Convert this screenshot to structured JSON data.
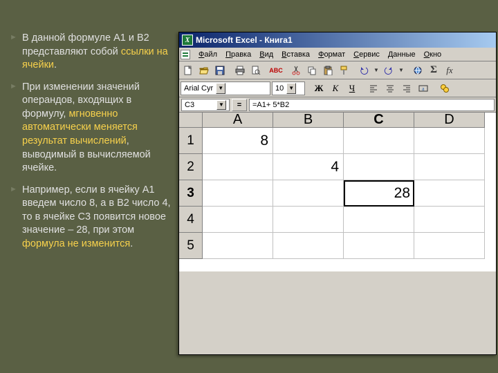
{
  "slide": {
    "bullets": [
      {
        "p1": "В данной формуле А1 и В2 представляют собой ",
        "y1": "ссылки на ячейки",
        "p2": "."
      },
      {
        "p1": "При изменении значений операндов, входящих в формулу, ",
        "y1": "мгновенно автоматически меняется результат вычислений",
        "p2": ", выводимый в вычисляемой ячейке."
      },
      {
        "p1": "Например, если в ячейку А1 введем число 8, а в В2 число 4, то в ячейке С3 появится новое значение – 28, при этом ",
        "y1": "формула не изменится",
        "p2": "."
      }
    ]
  },
  "excel": {
    "title": "Microsoft Excel - Книга1",
    "icon_letter": "X",
    "menus": [
      "Файл",
      "Правка",
      "Вид",
      "Вставка",
      "Формат",
      "Сервис",
      "Данные",
      "Окно"
    ],
    "font_name": "Arial Cyr",
    "font_size": "10",
    "bold": "Ж",
    "italic": "К",
    "under": "Ч",
    "name_box": "C3",
    "formula": "=A1+ 5*B2",
    "columns": [
      "A",
      "B",
      "C",
      "D"
    ],
    "rows": [
      "1",
      "2",
      "3",
      "4",
      "5"
    ],
    "active_col": 2,
    "active_row": 2,
    "cells": {
      "r0c0": "8",
      "r1c1": "4",
      "r2c2": "28"
    }
  }
}
